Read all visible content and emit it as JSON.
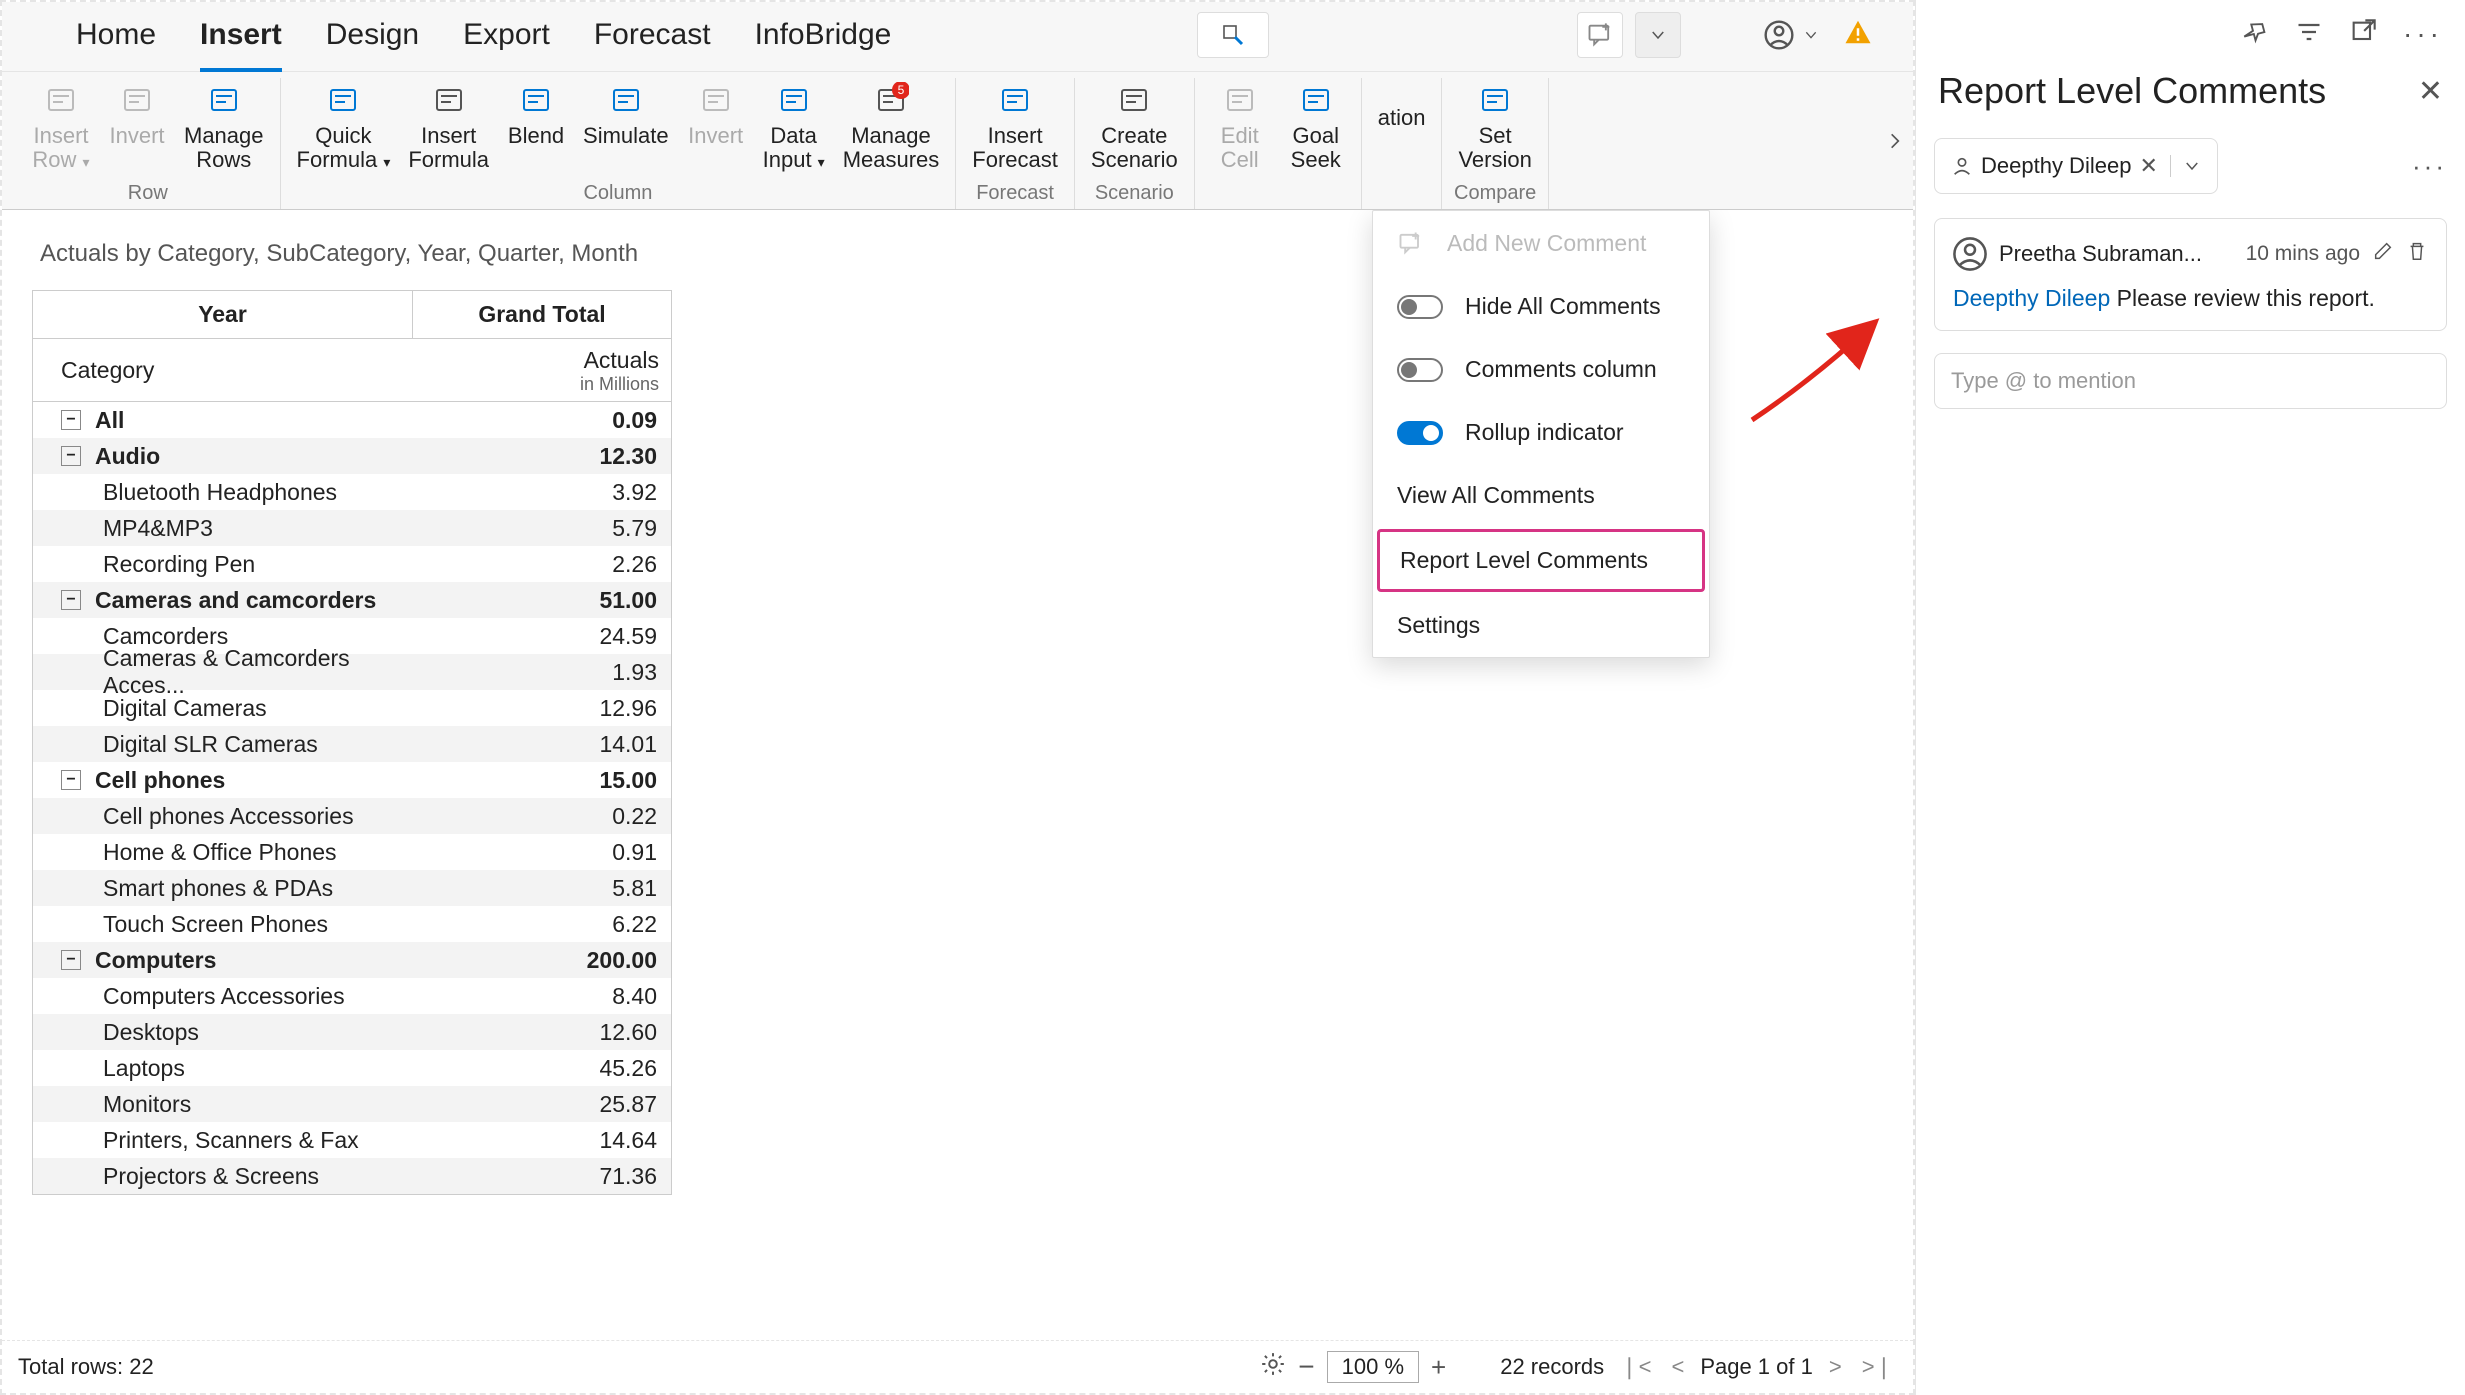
{
  "tabs": {
    "items": [
      "Home",
      "Insert",
      "Design",
      "Export",
      "Forecast",
      "InfoBridge"
    ],
    "activeIndex": 1
  },
  "ribbon": {
    "groups": [
      {
        "label": "Row",
        "buttons": [
          {
            "l1": "Insert",
            "l2": "Row",
            "dim": true,
            "drop": true,
            "color": "#888"
          },
          {
            "l1": "Invert",
            "dim": true,
            "color": "#888"
          },
          {
            "l1": "Manage",
            "l2": "Rows",
            "color": "#0078d4"
          }
        ]
      },
      {
        "label": "Column",
        "buttons": [
          {
            "l1": "Quick",
            "l2": "Formula",
            "drop": true,
            "color": "#0078d4"
          },
          {
            "l1": "Insert",
            "l2": "Formula",
            "color": "#555"
          },
          {
            "l1": "Blend",
            "color": "#0078d4"
          },
          {
            "l1": "Simulate",
            "color": "#0078d4"
          },
          {
            "l1": "Invert",
            "dim": true,
            "color": "#888"
          },
          {
            "l1": "Data",
            "l2": "Input",
            "drop": true,
            "color": "#0078d4"
          },
          {
            "l1": "Manage",
            "l2": "Measures",
            "badge": "5",
            "color": "#555"
          }
        ]
      },
      {
        "label": "Forecast",
        "buttons": [
          {
            "l1": "Insert",
            "l2": "Forecast",
            "color": "#0078d4"
          }
        ]
      },
      {
        "label": "Scenario",
        "buttons": [
          {
            "l1": "Create",
            "l2": "Scenario",
            "color": "#555"
          }
        ]
      },
      {
        "label": "",
        "buttons": [
          {
            "l1": "Edit",
            "l2": "Cell",
            "dim": true,
            "color": "#888"
          },
          {
            "l1": "Goal",
            "l2": "Seek",
            "color": "#0078d4"
          }
        ]
      },
      {
        "label": "",
        "buttons": [
          {
            "l1": "",
            "l2": "ation",
            "cut": true,
            "color": "#555"
          }
        ]
      },
      {
        "label": "Compare",
        "buttons": [
          {
            "l1": "Set",
            "l2": "Version",
            "color": "#0078d4"
          }
        ]
      }
    ]
  },
  "report": {
    "title": "Actuals by Category, SubCategory, Year, Quarter, Month",
    "colHeader": "Year",
    "grandTotal": "Grand Total",
    "rowHeader": "Category",
    "measure": "Actuals",
    "unit": "in Millions",
    "rows": [
      {
        "t": "cat",
        "label": "All",
        "val": "0.09"
      },
      {
        "t": "cat",
        "label": "Audio",
        "val": "12.30"
      },
      {
        "t": "sub",
        "label": "Bluetooth Headphones",
        "val": "3.92"
      },
      {
        "t": "sub",
        "label": "MP4&MP3",
        "val": "5.79"
      },
      {
        "t": "sub",
        "label": "Recording Pen",
        "val": "2.26"
      },
      {
        "t": "cat",
        "label": "Cameras and camcorders",
        "val": "51.00"
      },
      {
        "t": "sub",
        "label": "Camcorders",
        "val": "24.59"
      },
      {
        "t": "sub",
        "label": "Cameras & Camcorders Acces...",
        "val": "1.93"
      },
      {
        "t": "sub",
        "label": "Digital Cameras",
        "val": "12.96"
      },
      {
        "t": "sub",
        "label": "Digital SLR Cameras",
        "val": "14.01"
      },
      {
        "t": "cat",
        "label": "Cell phones",
        "val": "15.00"
      },
      {
        "t": "sub",
        "label": "Cell phones Accessories",
        "val": "0.22"
      },
      {
        "t": "sub",
        "label": "Home & Office Phones",
        "val": "0.91"
      },
      {
        "t": "sub",
        "label": "Smart phones & PDAs",
        "val": "5.81"
      },
      {
        "t": "sub",
        "label": "Touch Screen Phones",
        "val": "6.22"
      },
      {
        "t": "cat",
        "label": "Computers",
        "val": "200.00"
      },
      {
        "t": "sub",
        "label": "Computers Accessories",
        "val": "8.40"
      },
      {
        "t": "sub",
        "label": "Desktops",
        "val": "12.60"
      },
      {
        "t": "sub",
        "label": "Laptops",
        "val": "45.26"
      },
      {
        "t": "sub",
        "label": "Monitors",
        "val": "25.87"
      },
      {
        "t": "sub",
        "label": "Printers, Scanners & Fax",
        "val": "14.64"
      },
      {
        "t": "sub",
        "label": "Projectors & Screens",
        "val": "71.36"
      }
    ]
  },
  "footer": {
    "totalRows": "Total rows: 22",
    "zoom": "100 %",
    "records": "22 records",
    "page": "Page 1 of 1"
  },
  "dropdown": {
    "addNew": "Add New Comment",
    "hideAll": "Hide All Comments",
    "commentsCol": "Comments column",
    "rollup": "Rollup indicator",
    "viewAll": "View All Comments",
    "reportLevel": "Report Level Comments",
    "settings": "Settings"
  },
  "panel": {
    "title": "Report Level Comments",
    "chipName": "Deepthy Dileep",
    "author": "Preetha Subraman...",
    "time": "10 mins ago",
    "mention": "Deepthy Dileep",
    "text": "Please review this report.",
    "placeholder": "Type @ to mention"
  }
}
